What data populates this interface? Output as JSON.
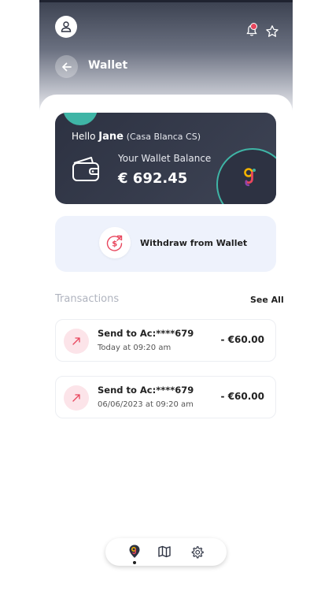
{
  "header": {
    "title": "Wallet",
    "icons": {
      "avatar": "user-icon",
      "back": "arrow-left-icon",
      "notifications": "bell-icon",
      "favorites": "star-icon"
    }
  },
  "wallet_card": {
    "greeting": "Hello",
    "user_name": "Jane",
    "organization": "(Casa Blanca CS)",
    "balance_label": "Your Wallet Balance",
    "balance_amount": "€ 692.45",
    "icons": {
      "wallet": "wallet-icon",
      "brand": "brand-logo-icon"
    }
  },
  "withdraw": {
    "label": "Withdraw from Wallet",
    "icon": "dollar-withdraw-icon"
  },
  "transactions": {
    "heading": "Transactions",
    "see_all": "See All",
    "items": [
      {
        "title": "Send to Ac:****679",
        "date": "Today at 09:20 am",
        "amount": "- €60.00",
        "icon": "arrow-up-right-icon"
      },
      {
        "title": "Send to Ac:****679",
        "date": "06/06/2023 at 09:20 am",
        "amount": "- €60.00",
        "icon": "arrow-up-right-icon"
      }
    ]
  },
  "bottom_nav": {
    "items": [
      {
        "icon": "home-logo-icon",
        "active": true
      },
      {
        "icon": "map-icon",
        "active": false
      },
      {
        "icon": "gear-icon",
        "active": false
      }
    ]
  },
  "colors": {
    "card_bg": "#2d3242",
    "accent_teal": "#3fb5a6",
    "accent_pink": "#e8465d",
    "withdraw_bg": "#eef2fc",
    "tx_icon_bg": "#fce4e9"
  }
}
